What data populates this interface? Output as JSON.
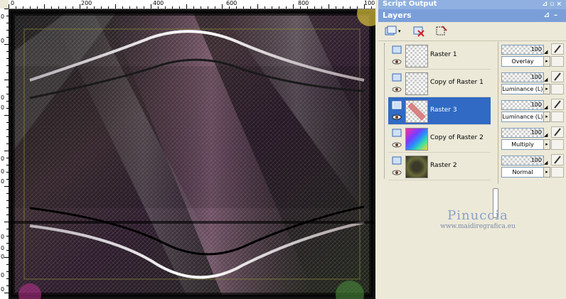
{
  "ruler": {
    "top_labels": [
      "0",
      "200",
      "400",
      "600",
      "800",
      "100"
    ],
    "left_labels": [
      "0",
      "0",
      "0",
      "0",
      "0",
      "0",
      "0",
      "0",
      "0",
      "0",
      "0",
      "0"
    ]
  },
  "script_output": {
    "title": "Script Output"
  },
  "layers_panel": {
    "title": "Layers",
    "layers": [
      {
        "name": "Raster 1",
        "opacity": "100",
        "blend": "Overlay",
        "selected": false
      },
      {
        "name": "Copy of Raster 1",
        "opacity": "100",
        "blend": "Luminance (L)",
        "selected": false
      },
      {
        "name": "Raster 3",
        "opacity": "100",
        "blend": "Luminance (L)",
        "selected": true
      },
      {
        "name": "Copy of Raster 2",
        "opacity": "100",
        "blend": "Multiply",
        "selected": false
      },
      {
        "name": "Raster 2",
        "opacity": "100",
        "blend": "Normal",
        "selected": false
      }
    ]
  },
  "watermark": {
    "name": "Pinuccia",
    "url": "www.maidiregrafica.eu"
  },
  "colors": {
    "selection": "#316ac5",
    "title_bar": "#7a9fd8",
    "panel_bg": "#ece9d8"
  }
}
